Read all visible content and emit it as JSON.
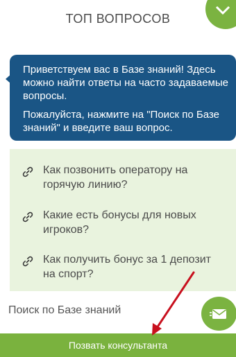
{
  "header": {
    "title": "ТОП ВОПРОСОВ"
  },
  "welcome": {
    "line1": "Приветствуем вас в Базе знаний! Здесь можно найти ответы на часто задаваемые вопросы.",
    "line2": "Пожалуйста, нажмите на \"Поиск по Базе знаний\" и введите ваш вопрос."
  },
  "faq": {
    "items": [
      {
        "label": "Как позвонить оператору на горячую линию?",
        "icon": "link-icon"
      },
      {
        "label": "Какие есть бонусы для новых игроков?",
        "icon": "link-icon"
      },
      {
        "label": "Как получить бонус за 1 депозит на спорт?",
        "icon": "link-icon"
      }
    ]
  },
  "search": {
    "placeholder": "Поиск по Базе знаний",
    "value": ""
  },
  "consult_button": {
    "label": "Позвать консультанта"
  },
  "colors": {
    "accent_green": "#7bb341",
    "bubble_blue": "#1a5585",
    "panel_bg": "#e9f3de",
    "annotation_red": "#c8101e"
  },
  "icons": {
    "corner": "chevron-down-icon",
    "send": "envelope-send-icon"
  }
}
